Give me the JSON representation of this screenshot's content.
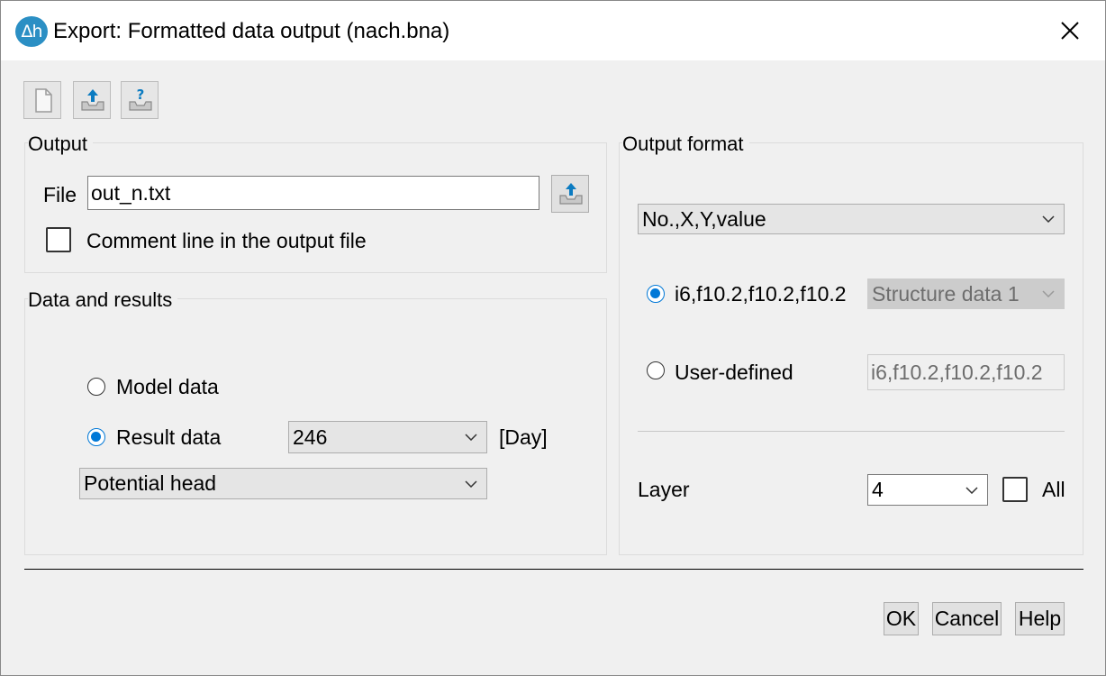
{
  "window": {
    "title": "Export: Formatted data output (nach.bna)",
    "app_icon_text": "Δh"
  },
  "toolbar": {
    "icons": [
      "new-document-icon",
      "upload-icon",
      "upload-help-icon"
    ]
  },
  "output": {
    "group_label": "Output",
    "file_label": "File",
    "file_value": "out_n.txt",
    "comment_label": "Comment line in the output file",
    "comment_checked": false
  },
  "data_results": {
    "group_label": "Data and results",
    "model_label": "Model data",
    "model_selected": false,
    "result_label": "Result data",
    "result_selected": true,
    "time_value": "246",
    "time_unit": "[Day]",
    "quantity_value": "Potential head"
  },
  "output_format": {
    "group_label": "Output format",
    "columns_value": "No.,X,Y,value",
    "preset_label": "i6,f10.2,f10.2,f10.2",
    "preset_selected": true,
    "structure_value": "Structure data 1",
    "user_label": "User-defined",
    "user_selected": false,
    "user_value": "i6,f10.2,f10.2,f10.2",
    "layer_label": "Layer",
    "layer_value": "4",
    "all_label": "All",
    "all_checked": false
  },
  "buttons": {
    "ok": "OK",
    "cancel": "Cancel",
    "help": "Help"
  },
  "colors": {
    "accent": "#0078d7",
    "app_icon": "#2b8fc4"
  }
}
